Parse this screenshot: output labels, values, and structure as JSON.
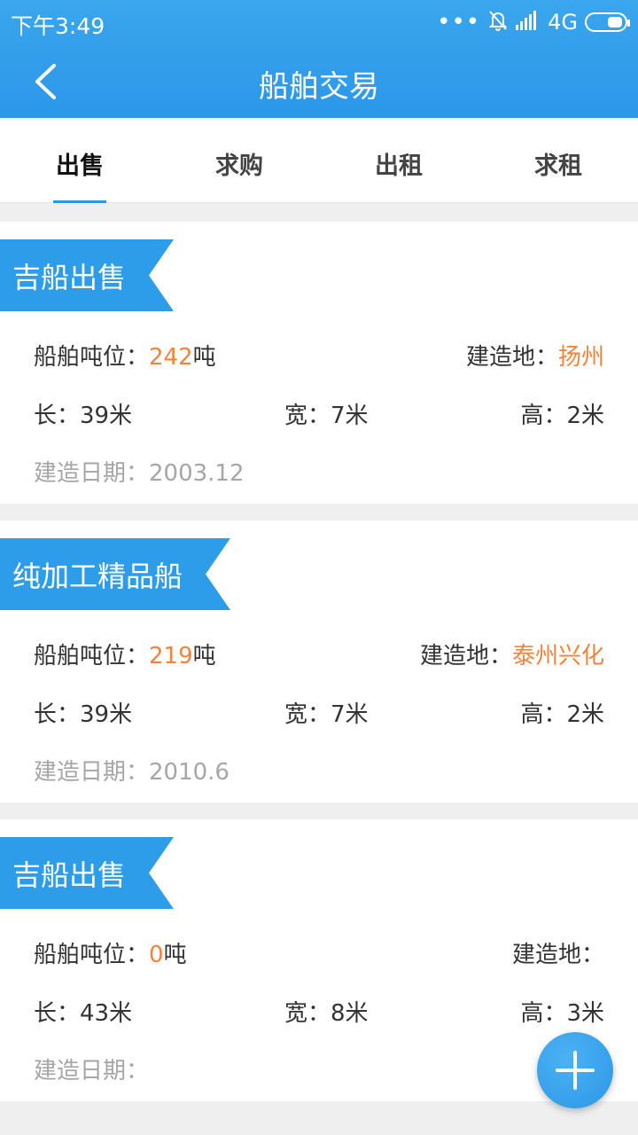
{
  "status_bar": {
    "time": "下午3:49",
    "network": "4G"
  },
  "header": {
    "title": "船舶交易"
  },
  "tabs": [
    {
      "label": "出售",
      "active": true
    },
    {
      "label": "求购",
      "active": false
    },
    {
      "label": "出租",
      "active": false
    },
    {
      "label": "求租",
      "active": false
    }
  ],
  "listings": [
    {
      "title": "吉船出售",
      "tonnage_label": "船舶吨位：",
      "tonnage_value": "242",
      "tonnage_unit": "吨",
      "origin_label": "建造地：",
      "origin_value": "扬州",
      "length": "长：39米",
      "width": "宽：7米",
      "height": "高：2米",
      "build_date": "建造日期：2003.12"
    },
    {
      "title": "纯加工精品船",
      "tonnage_label": "船舶吨位：",
      "tonnage_value": "219",
      "tonnage_unit": "吨",
      "origin_label": "建造地：",
      "origin_value": "泰州兴化",
      "length": "长：39米",
      "width": "宽：7米",
      "height": "高：2米",
      "build_date": "建造日期：2010.6"
    },
    {
      "title": "吉船出售",
      "tonnage_label": "船舶吨位：",
      "tonnage_value": "0",
      "tonnage_unit": "吨",
      "origin_label": "建造地：",
      "origin_value": "",
      "length": "长：43米",
      "width": "宽：8米",
      "height": "高：3米",
      "build_date": "建造日期："
    }
  ],
  "colors": {
    "primary": "#2b97e8",
    "accent": "#f0843c"
  },
  "icons": {
    "back": "chevron-left-icon",
    "add": "plus-icon"
  }
}
